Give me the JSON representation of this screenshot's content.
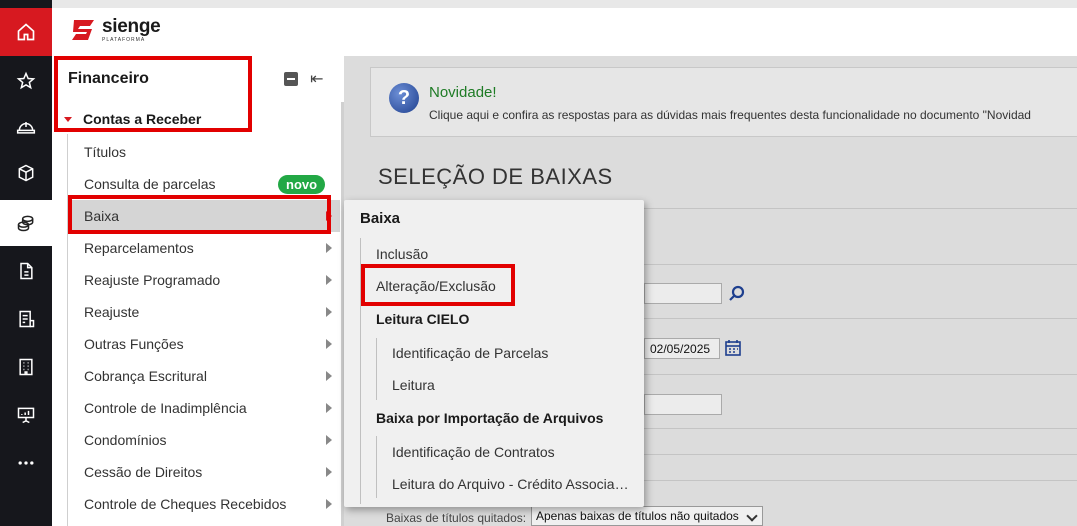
{
  "brand": {
    "name": "sienge",
    "tagline": "PLATAFORMA",
    "accent": "#d71920"
  },
  "rail": [
    {
      "icon": "home-icon"
    },
    {
      "icon": "star-icon"
    },
    {
      "icon": "helmet-icon"
    },
    {
      "icon": "box-icon"
    },
    {
      "icon": "coins-icon"
    },
    {
      "icon": "document-icon"
    },
    {
      "icon": "invoice-icon"
    },
    {
      "icon": "building-icon"
    },
    {
      "icon": "presentation-icon"
    },
    {
      "icon": "more-icon"
    }
  ],
  "sidebar": {
    "title": "Financeiro",
    "group": "Contas a Receber",
    "items": [
      {
        "label": "Títulos"
      },
      {
        "label": "Consulta de parcelas",
        "badge": "novo"
      },
      {
        "label": "Baixa"
      },
      {
        "label": "Reparcelamentos"
      },
      {
        "label": "Reajuste Programado"
      },
      {
        "label": "Reajuste"
      },
      {
        "label": "Outras Funções"
      },
      {
        "label": "Cobrança Escritural"
      },
      {
        "label": "Controle de Inadimplência"
      },
      {
        "label": "Condomínios"
      },
      {
        "label": "Cessão de Direitos"
      },
      {
        "label": "Controle de Cheques Recebidos"
      }
    ]
  },
  "notice": {
    "title": "Novidade!",
    "text": "Clique aqui e confira as respostas para as dúvidas mais frequentes desta funcionalidade no documento \"Novidad"
  },
  "main": {
    "title": "SELEÇÃO DE BAIXAS",
    "date_value": "02/05/2025",
    "bottom_label": "Baixas de títulos quitados:",
    "bottom_select": "Apenas baixas de títulos não quitados"
  },
  "flyout": {
    "title": "Baixa",
    "inclusao": "Inclusão",
    "alteracao": "Alteração/Exclusão",
    "leitura_cielo": "Leitura CIELO",
    "identificacao_parcelas": "Identificação de Parcelas",
    "leitura": "Leitura",
    "baixa_importacao": "Baixa por Importação de Arquivos",
    "identificacao_contratos": "Identificação de Contratos",
    "leitura_arquivo": "Leitura do Arquivo - Crédito Associa…"
  }
}
